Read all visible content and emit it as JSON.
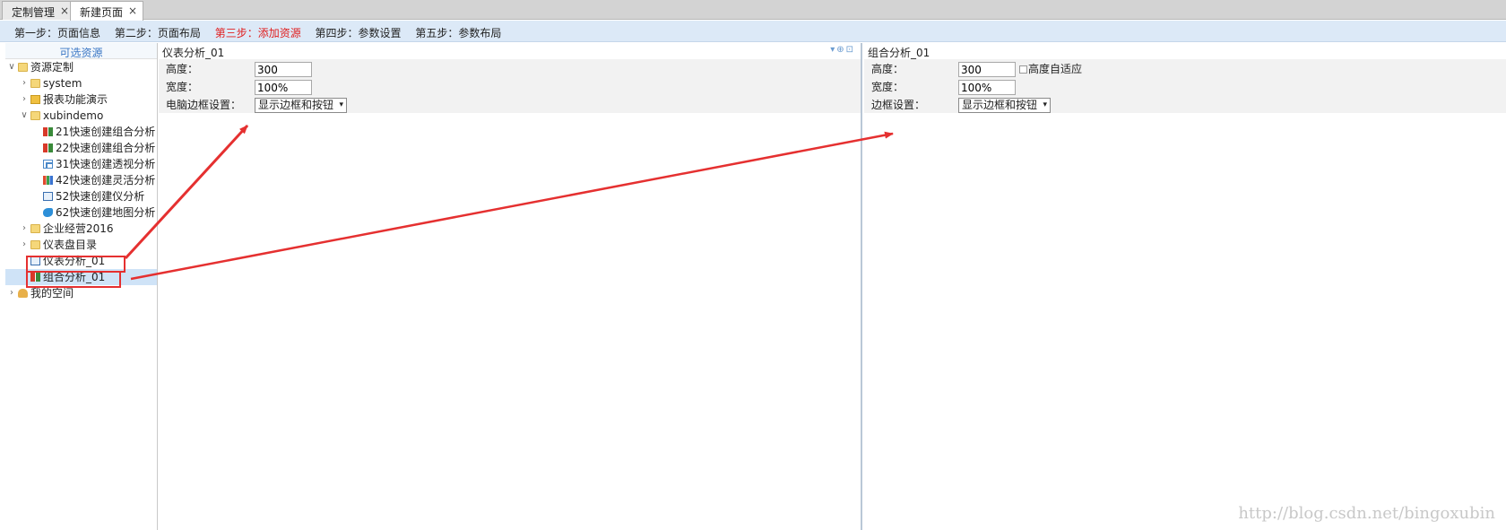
{
  "tabs": [
    {
      "label": "定制管理",
      "close": "×"
    },
    {
      "label": "新建页面",
      "close": "×"
    }
  ],
  "steps": [
    {
      "label": "第一步：页面信息"
    },
    {
      "label": "第二步：页面布局"
    },
    {
      "label": "第三步：添加资源",
      "current": true
    },
    {
      "label": "第四步：参数设置"
    },
    {
      "label": "第五步：参数布局"
    }
  ],
  "sidebar": {
    "title": "可选资源",
    "tree": [
      {
        "label": "资源定制",
        "icon": "folder-icon",
        "toggle": "∨"
      },
      {
        "label": "system",
        "icon": "folder-icon",
        "toggle": "›"
      },
      {
        "label": "报表功能演示",
        "icon": "locked-folder-icon",
        "toggle": "›"
      },
      {
        "label": "xubindemo",
        "icon": "folder-icon",
        "toggle": "∨"
      },
      {
        "label": "21快速创建组合分析",
        "icon": "combo-analysis-icon"
      },
      {
        "label": "22快速创建组合分析",
        "icon": "combo-analysis-icon"
      },
      {
        "label": "31快速创建透视分析",
        "icon": "pivot-analysis-icon"
      },
      {
        "label": "42快速创建灵活分析",
        "icon": "bar-chart-icon"
      },
      {
        "label": "52快速创建仪分析",
        "icon": "meter-analysis-icon"
      },
      {
        "label": "62快速创建地图分析",
        "icon": "map-analysis-icon"
      },
      {
        "label": "企业经营2016",
        "icon": "folder-icon",
        "toggle": "›"
      },
      {
        "label": "仪表盘目录",
        "icon": "folder-icon",
        "toggle": "›"
      },
      {
        "label": "仪表分析_01",
        "icon": "meter-analysis-icon"
      },
      {
        "label": "组合分析_01",
        "icon": "combo-analysis-icon",
        "selected": true
      },
      {
        "label": "我的空间",
        "icon": "user-space-icon",
        "toggle": "›"
      }
    ]
  },
  "panel_a": {
    "title": "仪表分析_01",
    "tools": "▾⊕⊡",
    "height_label": "高度：",
    "height_value": "300",
    "width_label": "宽度：",
    "width_value": "100%",
    "border_label": "电脑边框设置：",
    "border_value": "显示边框和按钮",
    "select_arrow": "▾"
  },
  "panel_b": {
    "title": "组合分析_01",
    "height_label": "高度：",
    "height_value": "300",
    "autofit_label": "高度自适应",
    "width_label": "宽度：",
    "width_value": "100%",
    "border_label": "边框设置：",
    "border_value": "显示边框和按钮",
    "select_arrow": "▾"
  },
  "watermark": "http://blog.csdn.net/bingoxubin",
  "colors": {
    "annotation": "#e53030",
    "current_step": "#e02020",
    "steps_bg": "#dce9f7",
    "selected_row": "#cfe3f7"
  }
}
